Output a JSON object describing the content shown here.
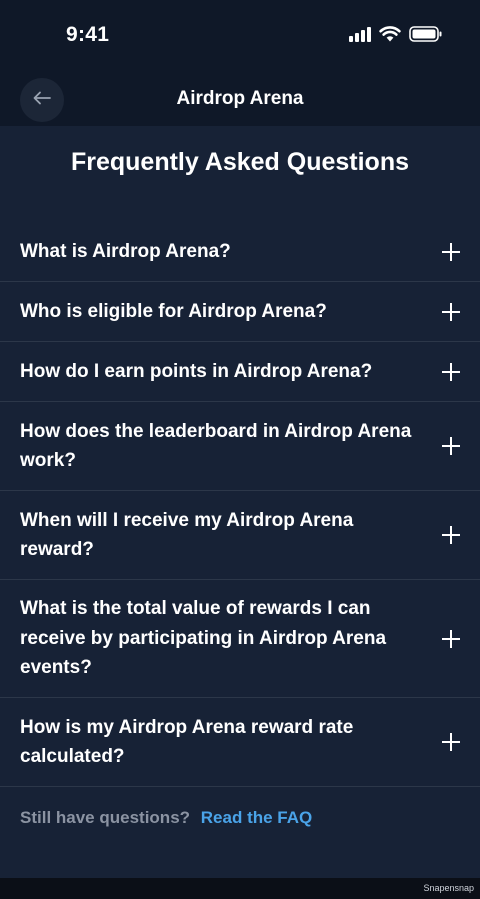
{
  "status_bar": {
    "time": "9:41",
    "icons": [
      "signal-icon",
      "wifi-icon",
      "battery-icon"
    ]
  },
  "nav": {
    "back_icon": "arrow-left-icon",
    "title": "Airdrop Arena"
  },
  "page": {
    "title": "Frequently Asked Questions"
  },
  "faq": {
    "expand_icon": "plus-icon",
    "items": [
      {
        "question": "What is Airdrop Arena?"
      },
      {
        "question": "Who is eligible for Airdrop Arena?"
      },
      {
        "question": "How do I earn points in Airdrop Arena?"
      },
      {
        "question": "How does the leaderboard in Airdrop Arena work?"
      },
      {
        "question": "When will I receive my Airdrop Arena reward?"
      },
      {
        "question": "What is the total value of rewards I can receive by participating in Airdrop Arena events?"
      },
      {
        "question": "How is my Airdrop Arena reward rate calculated?"
      }
    ]
  },
  "footer": {
    "prompt": "Still have questions?",
    "link_label": "Read the FAQ"
  },
  "watermark": "Snapensnap",
  "colors": {
    "background": "#172236",
    "header_background": "#0f1828",
    "divider": "#2c3749",
    "muted_text": "#8b93a2",
    "link": "#4aa3e8"
  }
}
